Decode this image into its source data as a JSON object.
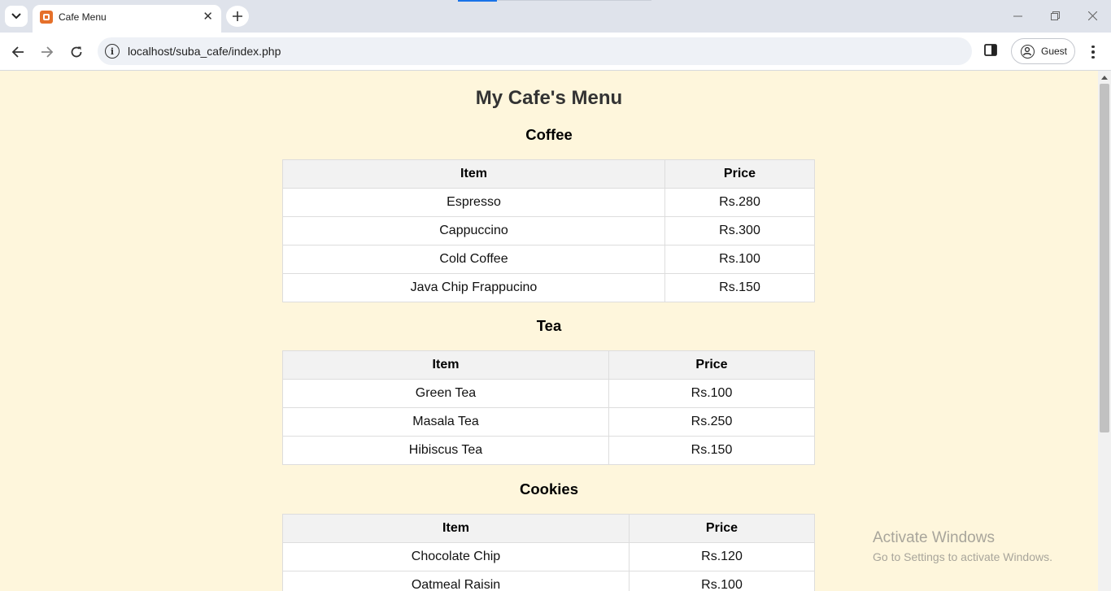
{
  "browser": {
    "tab_title": "Cafe Menu",
    "url": "localhost/suba_cafe/index.php",
    "profile_label": "Guest"
  },
  "page": {
    "title": "My Cafe's Menu",
    "sections": [
      {
        "name": "Coffee",
        "columns": [
          "Item",
          "Price"
        ],
        "rows": [
          [
            "Espresso",
            "Rs.280"
          ],
          [
            "Cappuccino",
            "Rs.300"
          ],
          [
            "Cold Coffee",
            "Rs.100"
          ],
          [
            "Java Chip Frappucino",
            "Rs.150"
          ]
        ]
      },
      {
        "name": "Tea",
        "columns": [
          "Item",
          "Price"
        ],
        "rows": [
          [
            "Green Tea",
            "Rs.100"
          ],
          [
            "Masala Tea",
            "Rs.250"
          ],
          [
            "Hibiscus Tea",
            "Rs.150"
          ]
        ]
      },
      {
        "name": "Cookies",
        "columns": [
          "Item",
          "Price"
        ],
        "rows": [
          [
            "Chocolate Chip",
            "Rs.120"
          ],
          [
            "Oatmeal Raisin",
            "Rs.100"
          ]
        ]
      }
    ]
  },
  "watermark": {
    "line1": "Activate Windows",
    "line2": "Go to Settings to activate Windows."
  },
  "colors": {
    "page_background": "#fef6dc",
    "table_header_background": "#f2f2f2",
    "favicon": "#e5702a"
  },
  "icons": [
    "tab-list-icon",
    "xampp-favicon-icon",
    "close-icon",
    "plus-icon",
    "minimize-icon",
    "restore-icon",
    "window-close-icon",
    "back-arrow-icon",
    "forward-arrow-icon",
    "reload-icon",
    "site-info-icon",
    "side-panel-icon",
    "profile-icon",
    "kebab-menu-icon"
  ]
}
